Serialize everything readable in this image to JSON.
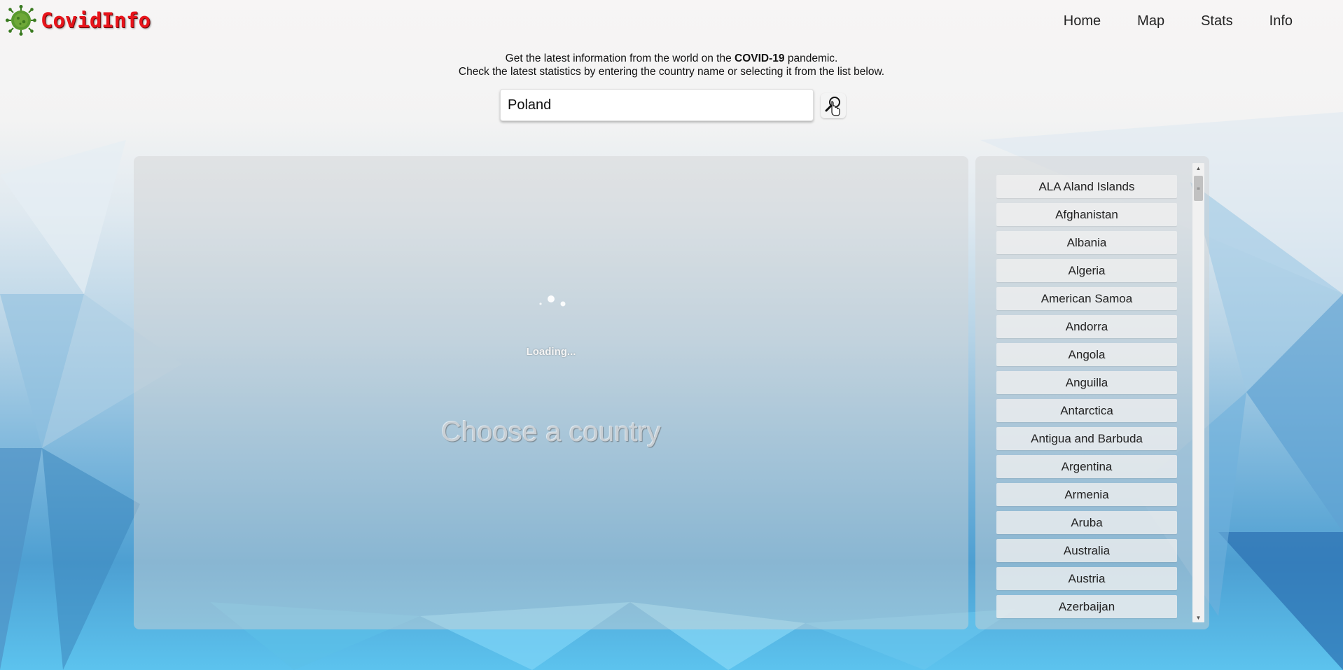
{
  "app": {
    "name": "CovidInfo",
    "logo_icon": "virus-icon"
  },
  "nav": {
    "items": [
      {
        "label": "Home"
      },
      {
        "label": "Map"
      },
      {
        "label": "Stats"
      },
      {
        "label": "Info"
      }
    ]
  },
  "intro": {
    "line1_before": "Get the latest information from the world on the ",
    "line1_bold": "COVID-19",
    "line1_after": " pandemic.",
    "line2": "Check the latest statistics by entering the country name or selecting it from the list below."
  },
  "search": {
    "value": "Poland",
    "button_icon": "search-icon"
  },
  "main": {
    "loading_text": "Loading...",
    "placeholder_text": "Choose a country"
  },
  "countries": [
    "ALA Aland Islands",
    "Afghanistan",
    "Albania",
    "Algeria",
    "American Samoa",
    "Andorra",
    "Angola",
    "Anguilla",
    "Antarctica",
    "Antigua and Barbuda",
    "Argentina",
    "Armenia",
    "Aruba",
    "Australia",
    "Austria",
    "Azerbaijan"
  ],
  "colors": {
    "logo_text": "#e8141b",
    "logo_icon": "#4a8a2a"
  }
}
